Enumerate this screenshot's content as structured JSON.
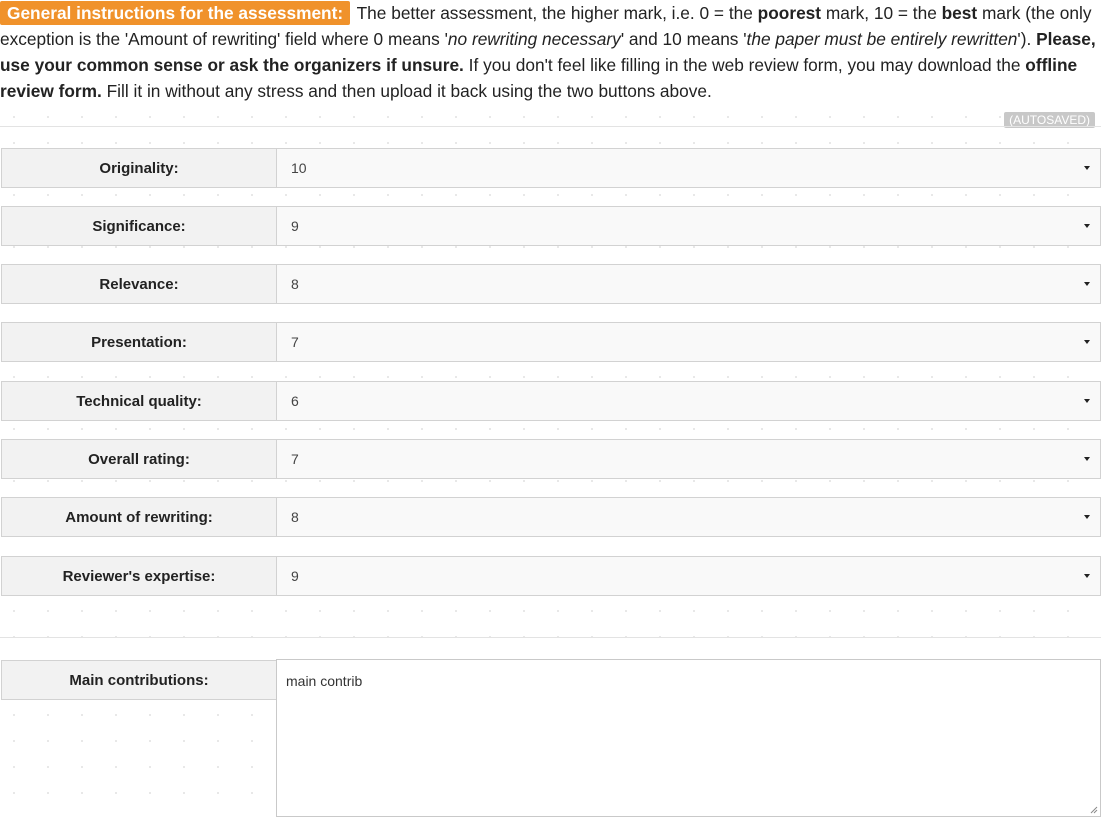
{
  "instructions": {
    "badge": "General instructions for the assessment:",
    "t1": "The better assessment, the higher mark, i.e. 0 = the",
    "b1": "poorest",
    "t2": "mark, 10 = the",
    "b2": "best",
    "t3": "mark (the only exception is the 'Amount of rewriting' field where 0 means '",
    "i1": "no rewriting necessary",
    "t4": "' and 10 means '",
    "i2": "the paper must be entirely rewritten",
    "t5": "').",
    "b3": "Please, use your common sense or ask the organizers if unsure.",
    "t6": "If you don't feel like filling in the web review form, you may download the",
    "b4": "offline review form.",
    "t7": "Fill it in without any stress and then upload it back using the two buttons above."
  },
  "autosaved": "(AUTOSAVED)",
  "ratings": [
    {
      "label": "Originality:",
      "value": "10"
    },
    {
      "label": "Significance:",
      "value": "9"
    },
    {
      "label": "Relevance:",
      "value": "8"
    },
    {
      "label": "Presentation:",
      "value": "7"
    },
    {
      "label": "Technical quality:",
      "value": "6"
    },
    {
      "label": "Overall rating:",
      "value": "7"
    },
    {
      "label": "Amount of rewriting:",
      "value": "8"
    },
    {
      "label": "Reviewer's expertise:",
      "value": "9"
    }
  ],
  "contributions": {
    "label": "Main contributions:",
    "value": "main contrib"
  }
}
